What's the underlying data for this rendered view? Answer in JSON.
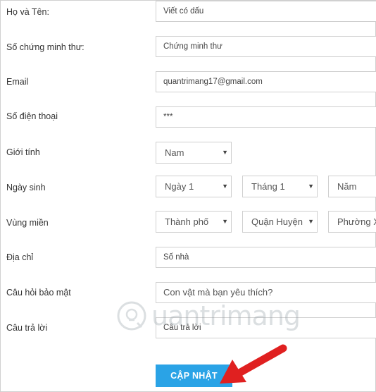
{
  "form": {
    "fullname": {
      "label": "Họ và Tên:",
      "value": "Viết có dấu"
    },
    "id_number": {
      "label": "Số chứng minh thư:",
      "value": "Chứng minh thư"
    },
    "email": {
      "label": "Email",
      "value": "quantrimang17@gmail.com"
    },
    "phone": {
      "label": "Số điện thoại",
      "value": "***"
    },
    "gender": {
      "label": "Giới tính",
      "selected": "Nam"
    },
    "birthdate": {
      "label": "Ngày sinh",
      "day": "Ngày 1",
      "month": "Tháng 1",
      "year": "Năm"
    },
    "region": {
      "label": "Vùng miền",
      "city": "Thành phố",
      "district": "Quận Huyện",
      "ward": "Phường X"
    },
    "address": {
      "label": "Địa chỉ",
      "value": "Số nhà"
    },
    "security_question": {
      "label": "Câu hỏi bảo mật",
      "value": "Con vật mà bạn yêu thích?"
    },
    "answer": {
      "label": "Câu trả lời",
      "value": "Câu trả lời"
    },
    "submit_label": "CẬP NHẬT"
  },
  "watermark": {
    "text": "uantrimang"
  },
  "colors": {
    "button": "#2aa3e6",
    "arrow": "#e02020"
  }
}
